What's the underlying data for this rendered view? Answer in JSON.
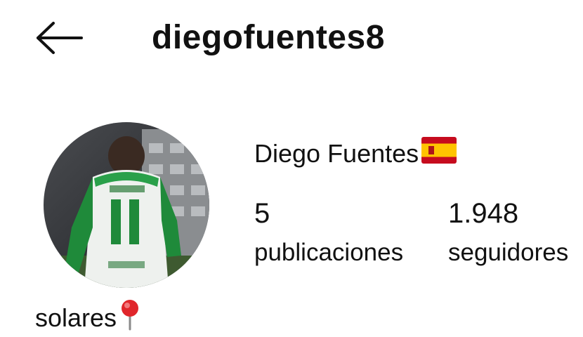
{
  "header": {
    "username": "diegofuentes8",
    "back_icon": "arrow-left-icon"
  },
  "profile": {
    "display_name": "Diego Fuentes",
    "flag_icon": "spain-flag-icon",
    "avatar_icon": "profile-photo-soccer-player",
    "stats": [
      {
        "value": "5",
        "label": "publicaciones"
      },
      {
        "value": "1.948",
        "label": "seguidores"
      }
    ],
    "bio": "solares",
    "bio_icon": "round-pushpin-icon"
  },
  "colors": {
    "text": "#111111",
    "background": "#ffffff",
    "jersey_green": "#1f8a3a",
    "flag_red": "#c60b1e",
    "flag_yellow": "#ffc400",
    "pin_red": "#e0262b"
  }
}
